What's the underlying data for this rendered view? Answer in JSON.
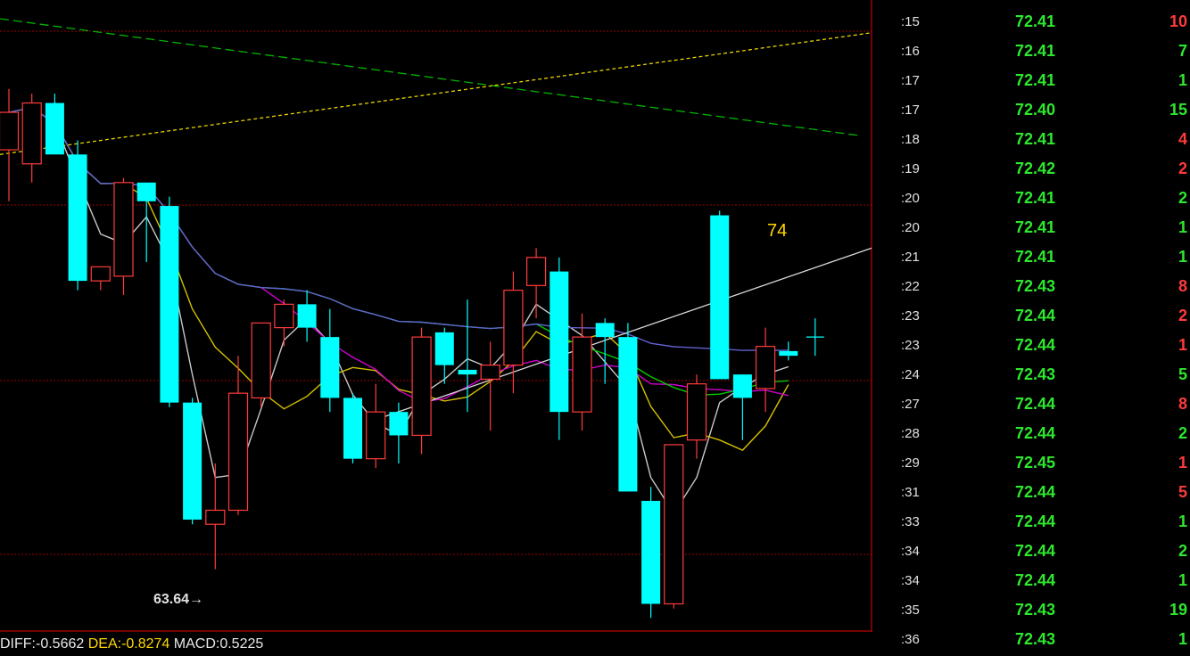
{
  "colors": {
    "up": "#ff3b3b",
    "down": "#00ffff",
    "grid": "#9c0000",
    "ma_white": "#c8c8c8",
    "ma_yellow": "#d4c000",
    "ma_magenta": "#cc00cc",
    "ma_green": "#00c800",
    "ma_blue": "#6060d0",
    "price_green": "#2ee82e",
    "vol_red": "#ff3b3b",
    "vol_green": "#2ee82e"
  },
  "chart_data": {
    "type": "candlestick",
    "ylim": [
      62.3,
      75.8
    ],
    "low_marker": {
      "price": 63.64,
      "label": "63.64",
      "arrow": "→"
    },
    "value_marker": "74",
    "candles": [
      {
        "o": 72.6,
        "h": 73.9,
        "l": 71.5,
        "c": 73.4
      },
      {
        "o": 72.3,
        "h": 73.8,
        "l": 71.9,
        "c": 73.6
      },
      {
        "o": 73.6,
        "h": 73.8,
        "l": 72.6,
        "c": 72.5
      },
      {
        "o": 72.5,
        "h": 72.8,
        "l": 69.6,
        "c": 69.8
      },
      {
        "o": 69.8,
        "h": 70.0,
        "l": 69.6,
        "c": 70.1
      },
      {
        "o": 69.9,
        "h": 72.0,
        "l": 69.5,
        "c": 71.9
      },
      {
        "o": 71.9,
        "h": 71.9,
        "l": 70.2,
        "c": 71.5
      },
      {
        "o": 71.4,
        "h": 71.6,
        "l": 67.1,
        "c": 67.2
      },
      {
        "o": 67.2,
        "h": 67.3,
        "l": 64.6,
        "c": 64.7
      },
      {
        "o": 64.6,
        "h": 65.9,
        "l": 63.64,
        "c": 64.9
      },
      {
        "o": 64.9,
        "h": 68.2,
        "l": 64.8,
        "c": 67.4
      },
      {
        "o": 67.3,
        "h": 68.7,
        "l": 67.1,
        "c": 68.9
      },
      {
        "o": 68.8,
        "h": 69.4,
        "l": 68.4,
        "c": 69.3
      },
      {
        "o": 69.3,
        "h": 69.6,
        "l": 68.5,
        "c": 68.8
      },
      {
        "o": 68.6,
        "h": 69.2,
        "l": 67.0,
        "c": 67.3
      },
      {
        "o": 67.3,
        "h": 67.4,
        "l": 65.9,
        "c": 66.0
      },
      {
        "o": 66.0,
        "h": 67.6,
        "l": 65.8,
        "c": 67.0
      },
      {
        "o": 67.0,
        "h": 67.2,
        "l": 65.9,
        "c": 66.5
      },
      {
        "o": 66.5,
        "h": 68.8,
        "l": 66.1,
        "c": 68.6
      },
      {
        "o": 68.7,
        "h": 68.8,
        "l": 67.6,
        "c": 68.0
      },
      {
        "o": 67.9,
        "h": 69.4,
        "l": 67.0,
        "c": 67.8
      },
      {
        "o": 67.7,
        "h": 68.5,
        "l": 66.6,
        "c": 68.0
      },
      {
        "o": 68.0,
        "h": 70.0,
        "l": 67.4,
        "c": 69.6
      },
      {
        "o": 69.7,
        "h": 70.5,
        "l": 69.0,
        "c": 70.3
      },
      {
        "o": 70.0,
        "h": 70.3,
        "l": 66.4,
        "c": 67.0
      },
      {
        "o": 67.0,
        "h": 69.1,
        "l": 66.6,
        "c": 68.6
      },
      {
        "o": 68.9,
        "h": 69.0,
        "l": 67.6,
        "c": 68.6
      },
      {
        "o": 68.6,
        "h": 68.9,
        "l": 66.3,
        "c": 65.3
      },
      {
        "o": 65.1,
        "h": 65.4,
        "l": 62.6,
        "c": 62.9
      },
      {
        "o": 62.9,
        "h": 66.3,
        "l": 62.8,
        "c": 66.3
      },
      {
        "o": 66.4,
        "h": 67.8,
        "l": 66.0,
        "c": 67.6
      },
      {
        "o": 71.2,
        "h": 71.3,
        "l": 67.8,
        "c": 67.7
      },
      {
        "o": 67.8,
        "h": 67.8,
        "l": 66.4,
        "c": 67.3
      },
      {
        "o": 67.5,
        "h": 68.8,
        "l": 67.0,
        "c": 68.4
      },
      {
        "o": 68.3,
        "h": 68.5,
        "l": 68.1,
        "c": 68.2
      }
    ]
  },
  "ticks": [
    {
      "time": ":15",
      "price": "72.41",
      "vol": "10",
      "vol_color": "red"
    },
    {
      "time": ":16",
      "price": "72.41",
      "vol": "7",
      "vol_color": "green"
    },
    {
      "time": ":17",
      "price": "72.41",
      "vol": "1",
      "vol_color": "green"
    },
    {
      "time": ":17",
      "price": "72.40",
      "vol": "15",
      "vol_color": "green"
    },
    {
      "time": ":18",
      "price": "72.41",
      "vol": "4",
      "vol_color": "red"
    },
    {
      "time": ":19",
      "price": "72.42",
      "vol": "2",
      "vol_color": "red"
    },
    {
      "time": ":20",
      "price": "72.41",
      "vol": "2",
      "vol_color": "green"
    },
    {
      "time": ":20",
      "price": "72.41",
      "vol": "1",
      "vol_color": "green"
    },
    {
      "time": ":21",
      "price": "72.41",
      "vol": "1",
      "vol_color": "green"
    },
    {
      "time": ":22",
      "price": "72.43",
      "vol": "8",
      "vol_color": "red"
    },
    {
      "time": ":23",
      "price": "72.44",
      "vol": "2",
      "vol_color": "red"
    },
    {
      "time": ":23",
      "price": "72.44",
      "vol": "1",
      "vol_color": "red"
    },
    {
      "time": ":24",
      "price": "72.43",
      "vol": "5",
      "vol_color": "green"
    },
    {
      "time": ":27",
      "price": "72.44",
      "vol": "8",
      "vol_color": "red"
    },
    {
      "time": ":28",
      "price": "72.44",
      "vol": "2",
      "vol_color": "green"
    },
    {
      "time": ":29",
      "price": "72.45",
      "vol": "1",
      "vol_color": "red"
    },
    {
      "time": ":31",
      "price": "72.44",
      "vol": "5",
      "vol_color": "red"
    },
    {
      "time": ":33",
      "price": "72.44",
      "vol": "1",
      "vol_color": "green"
    },
    {
      "time": ":34",
      "price": "72.44",
      "vol": "2",
      "vol_color": "green"
    },
    {
      "time": ":34",
      "price": "72.44",
      "vol": "1",
      "vol_color": "green"
    },
    {
      "time": ":35",
      "price": "72.43",
      "vol": "19",
      "vol_color": "green"
    },
    {
      "time": ":36",
      "price": "72.43",
      "vol": "1",
      "vol_color": "green"
    }
  ],
  "macd": {
    "diff_label": "DIFF:-0.5662",
    "dea_label": "DEA:-0.8274",
    "macd_label": "MACD:0.5225"
  }
}
